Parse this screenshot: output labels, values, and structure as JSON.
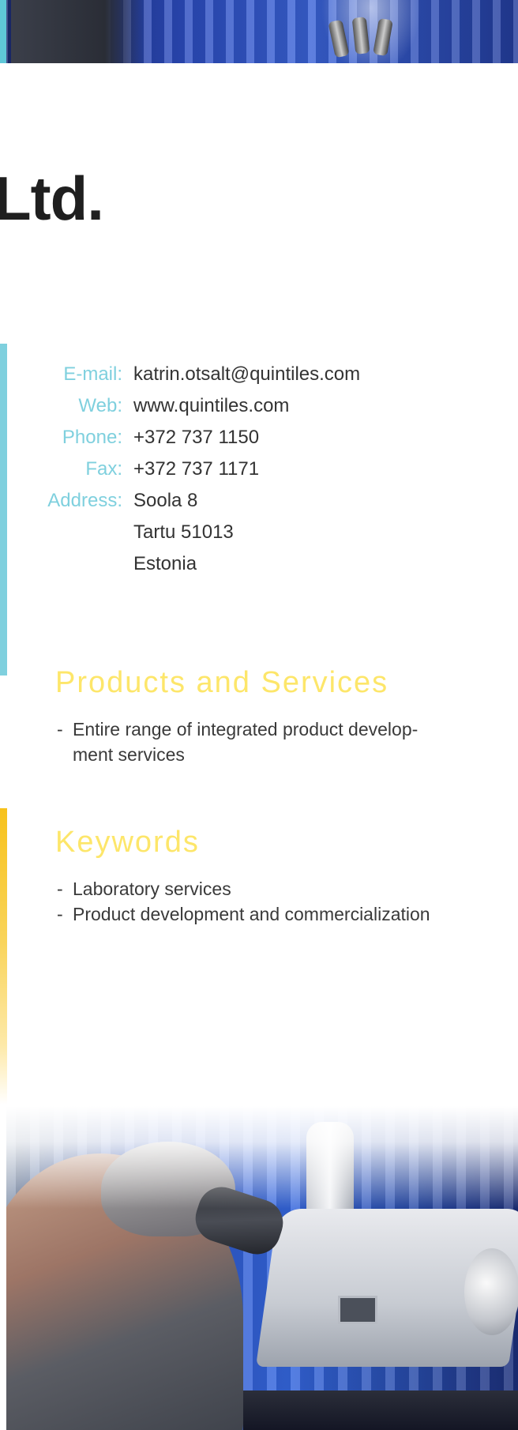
{
  "page": {
    "title_fragment": "Ltd."
  },
  "contact": {
    "email": {
      "label": "E-mail:",
      "value": "katrin.otsalt@quintiles.com"
    },
    "web": {
      "label": "Web:",
      "value": "www.quintiles.com"
    },
    "phone": {
      "label": "Phone:",
      "value": "+372 737 1150"
    },
    "fax": {
      "label": "Fax:",
      "value": "+372 737 1171"
    },
    "address": {
      "label": "Address:",
      "lines": [
        "Soola 8",
        "Tartu 51013",
        "Estonia"
      ]
    }
  },
  "products": {
    "heading": "Products and Services",
    "items": [
      "Entire range of integrated product develop-\nment services"
    ]
  },
  "keywords": {
    "heading": "Keywords",
    "items": [
      "Laboratory services",
      "Product development and commercialization"
    ]
  },
  "colors": {
    "accent_cyan": "#7fd0de",
    "accent_yellow": "#fde66a",
    "text": "#333333"
  },
  "images": {
    "top": "microscope-photo-strip",
    "bottom": "scientist-at-microscope-photo"
  }
}
